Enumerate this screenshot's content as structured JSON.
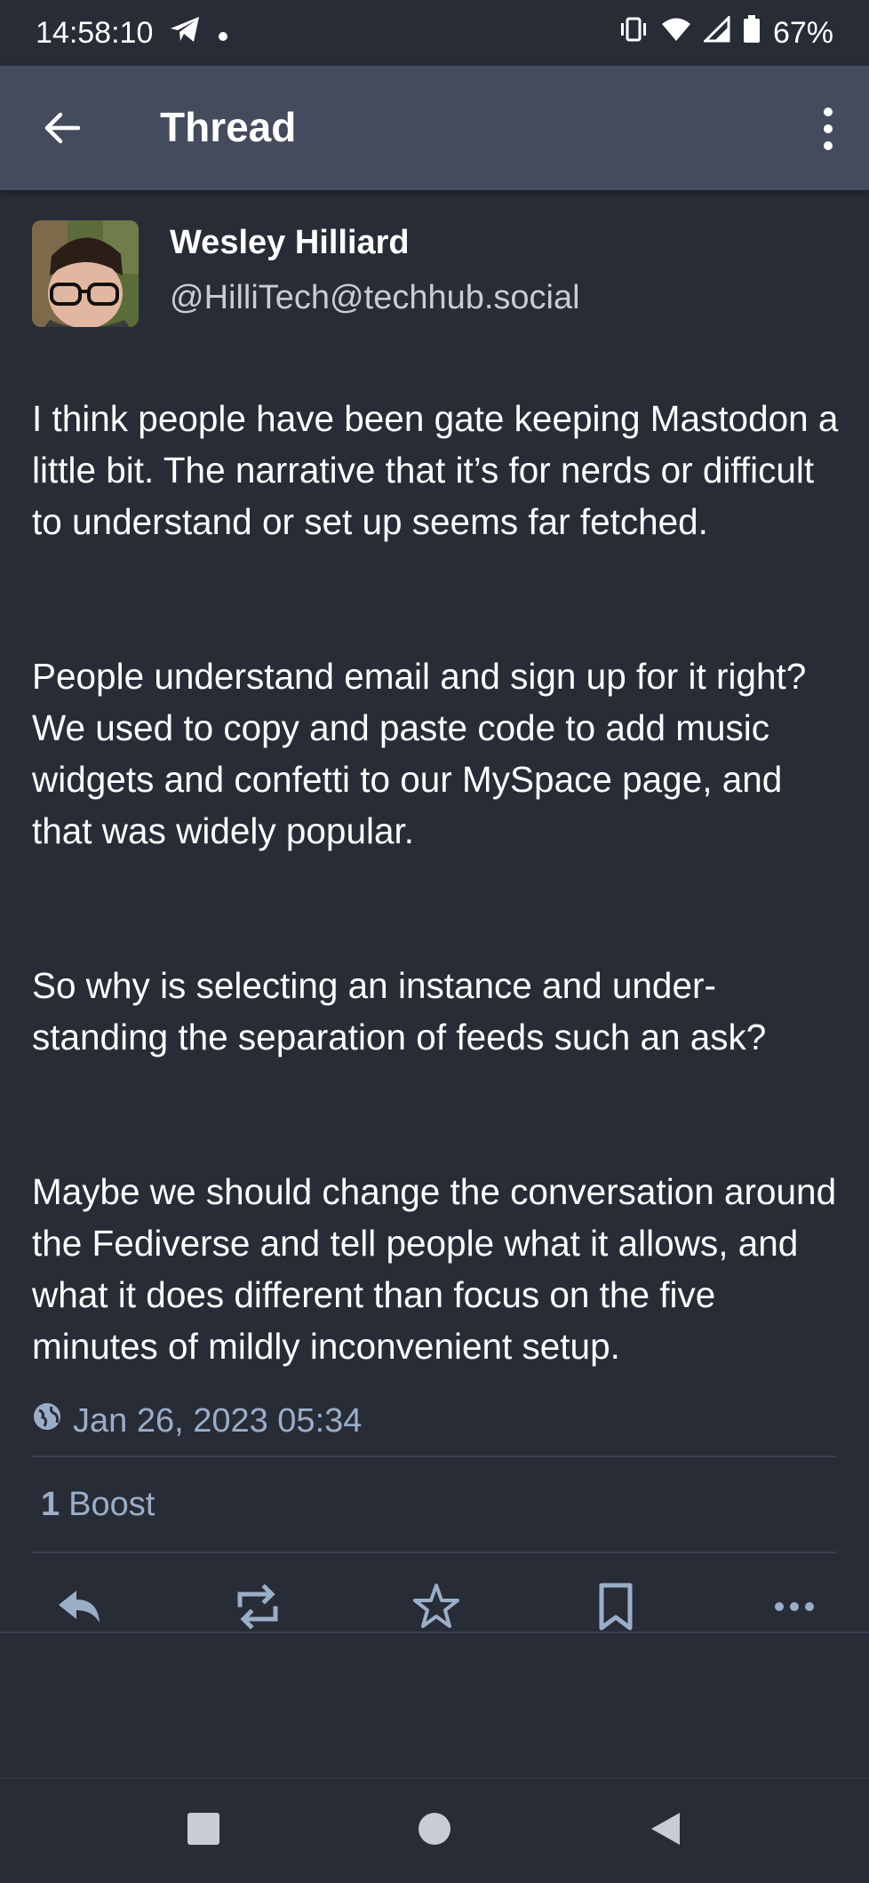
{
  "status_bar": {
    "time": "14:58:10",
    "battery": "67%"
  },
  "app_bar": {
    "title": "Thread"
  },
  "post": {
    "author_name": "Wesley Hilliard",
    "author_handle": "@HilliTech@techhub.social",
    "paragraphs": [
      "I think people have been gate keeping Mastodon a little bit. The narrative that it’s for nerds or difficult to understand or set up seems far fetched.",
      "People understand email and sign up for it right? We used to copy and paste code to add music widgets and confetti to our MySpace page, and that was widely popular.",
      "So why is selecting an instance and under-standing the separation of feeds such an ask?",
      "Maybe we should change the conversation around the Fediverse and tell people what it allows, and what it does different than focus on the five minutes of mildly inconvenient setup."
    ],
    "timestamp": "Jan 26, 2023 05:34",
    "boost_count": "1",
    "boost_label": "Boost"
  },
  "icons": {
    "status_left": [
      "telegram-icon",
      "dot-icon"
    ],
    "status_right": [
      "vibrate-icon",
      "wifi-icon",
      "signal-icon",
      "battery-icon"
    ],
    "actions": [
      "reply-icon",
      "boost-icon",
      "favourite-icon",
      "bookmark-icon",
      "more-icon"
    ],
    "nav": [
      "recents-icon",
      "home-icon",
      "back-nav-icon"
    ]
  },
  "colors": {
    "background": "#282c37",
    "app_bar": "#444b5d",
    "secondary_text": "#9baec8"
  }
}
